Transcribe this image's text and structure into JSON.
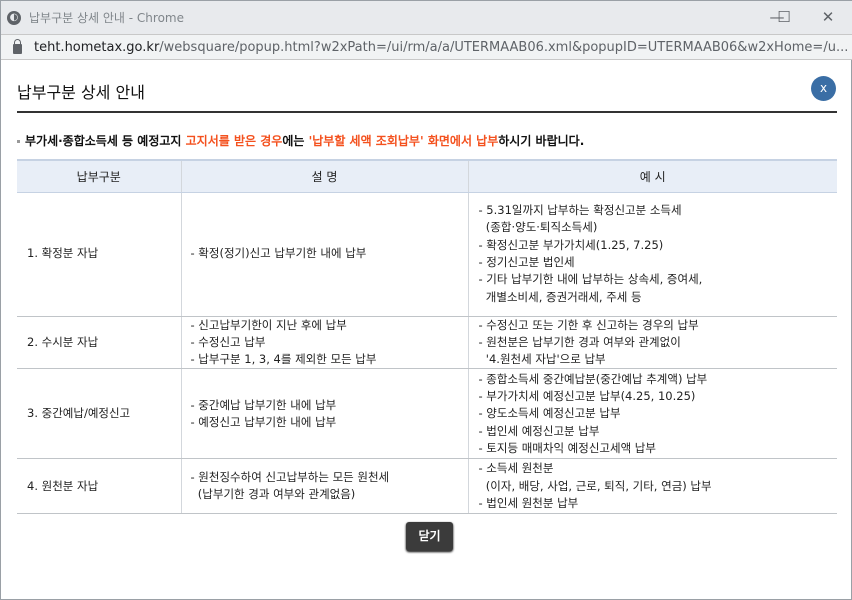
{
  "window": {
    "title": "납부구분 상세 안내 - Chrome",
    "url_host": "teht.hometax.go.kr",
    "url_path": "/websquare/popup.html?w2xPath=/ui/rm/a/a/UTERMAAB06.xml&popupID=UTERMAAB06&w2xHome=/u..."
  },
  "popup": {
    "title": "납부구분 상세 안내",
    "close_icon": "x",
    "notice": {
      "part1": "부가세·종합소득세 등 예정고지 ",
      "part2": "고지서를 받은 경우",
      "part3": "에는 ",
      "part4": "'납부할 세액 조회납부' 화면에서 납부",
      "part5": "하시기 바랍니다."
    },
    "table": {
      "headers": [
        "납부구분",
        "설 명",
        "예 시"
      ],
      "rows": [
        {
          "type": "1. 확정분 자납",
          "desc": [
            "- 확정(정기)신고 납부기한 내에 납부"
          ],
          "examples": [
            "- 5.31일까지 납부하는 확정신고분 소득세",
            "  (종합·양도·퇴직소득세)",
            "- 확정신고분 부가가치세(1.25, 7.25)",
            "- 정기신고분 법인세",
            "- 기타 납부기한 내에 납부하는 상속세, 증여세,",
            "  개별소비세, 증권거래세, 주세 등"
          ]
        },
        {
          "type": "2. 수시분 자납",
          "desc": [
            "- 신고납부기한이 지난 후에 납부",
            "- 수정신고 납부",
            "- 납부구분 1, 3, 4를 제외한 모든 납부"
          ],
          "examples": [
            "- 수정신고 또는 기한 후 신고하는 경우의 납부",
            "- 원천분은 납부기한 경과 여부와 관계없이",
            "  '4.원천세 자납'으로 납부"
          ]
        },
        {
          "type": "3. 중간예납/예정신고",
          "desc": [
            "- 중간예납 납부기한 내에 납부",
            "- 예정신고 납부기한 내에 납부"
          ],
          "examples": [
            "- 종합소득세 중간예납분(중간예납 추계액) 납부",
            "- 부가가치세 예정신고분 납부(4.25, 10.25)",
            "- 양도소득세 예정신고분 납부",
            "- 법인세 예정신고분 납부",
            "- 토지등 매매차익 예정신고세액 납부"
          ]
        },
        {
          "type": "4. 원천분 자납",
          "desc": [
            "- 원천징수하여 신고납부하는 모든 원천세",
            "  (납부기한 경과 여부와 관계없음)"
          ],
          "examples": [
            "- 소득세 원천분",
            "  (이자, 배당, 사업, 근로, 퇴직, 기타, 연금) 납부",
            "- 법인세 원천분 납부"
          ]
        }
      ]
    },
    "close_label": "닫기"
  }
}
